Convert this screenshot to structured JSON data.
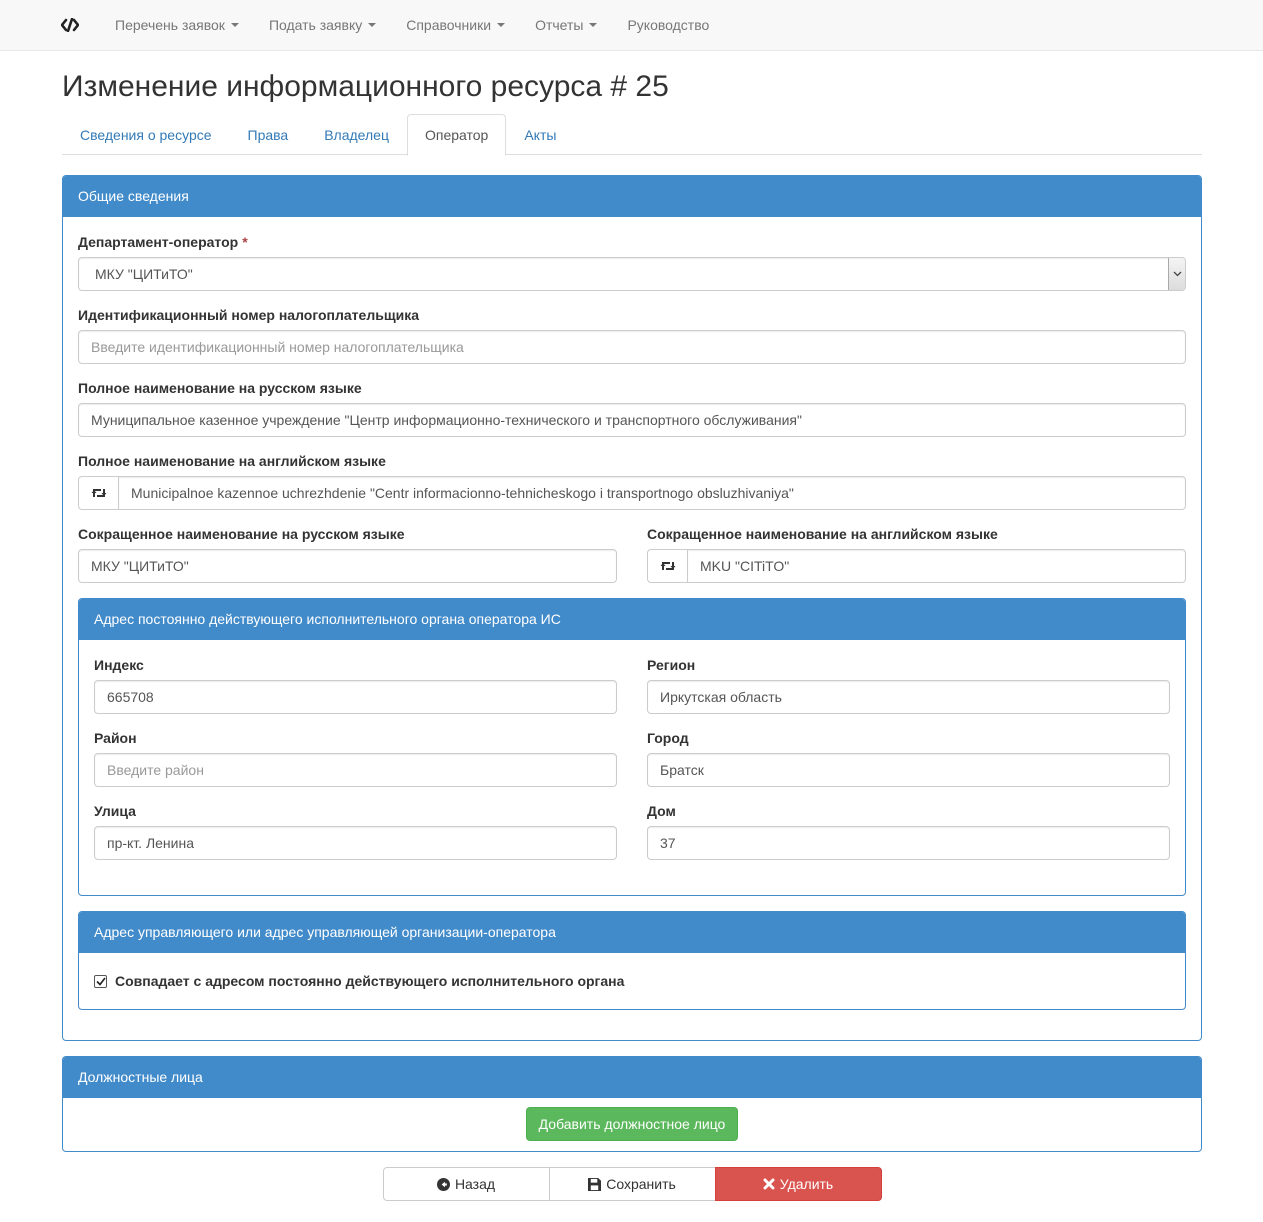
{
  "nav": {
    "items": [
      {
        "label": "Перечень заявок",
        "dropdown": true
      },
      {
        "label": "Подать заявку",
        "dropdown": true
      },
      {
        "label": "Справочники",
        "dropdown": true
      },
      {
        "label": "Отчеты",
        "dropdown": true
      },
      {
        "label": "Руководство",
        "dropdown": false
      }
    ]
  },
  "page": {
    "title": "Изменение информационного ресурса # 25"
  },
  "tabs": [
    {
      "label": "Сведения о ресурсе",
      "active": false
    },
    {
      "label": "Права",
      "active": false
    },
    {
      "label": "Владелец",
      "active": false
    },
    {
      "label": "Оператор",
      "active": true
    },
    {
      "label": "Акты",
      "active": false
    }
  ],
  "general": {
    "heading": "Общие сведения",
    "department": {
      "label": "Департамент-оператор",
      "required_mark": "*",
      "value": "МКУ \"ЦИТиТО\""
    },
    "inn": {
      "label": "Идентификационный номер налогоплательщика",
      "placeholder": "Введите идентификационный номер налогоплательщика"
    },
    "full_ru": {
      "label": "Полное наименование на русском языке",
      "value": "Муниципальное казенное учреждение \"Центр информационно-технического и транспортного обслуживания\""
    },
    "full_en": {
      "label": "Полное наименование на английском языке",
      "value": "Municipalnoe kazennoe uchrezhdenie \"Centr informacionno-tehnicheskogo i transportnogo obsluzhivaniya\""
    },
    "short_ru": {
      "label": "Сокращенное наименование на русском языке",
      "value": "МКУ \"ЦИТиТО\""
    },
    "short_en": {
      "label": "Сокращенное наименование на английском языке",
      "value": "MKU \"CITiTO\""
    }
  },
  "address": {
    "heading": "Адрес постоянно действующего исполнительного органа оператора ИС",
    "index": {
      "label": "Индекс",
      "value": "665708"
    },
    "region": {
      "label": "Регион",
      "value": "Иркутская область"
    },
    "district": {
      "label": "Район",
      "placeholder": "Введите район"
    },
    "city": {
      "label": "Город",
      "value": "Братск"
    },
    "street": {
      "label": "Улица",
      "value": "пр-кт. Ленина"
    },
    "house": {
      "label": "Дом",
      "value": "37"
    }
  },
  "manager_address": {
    "heading": "Адрес управляющего или адрес управляющей организации-оператора",
    "same_checkbox": {
      "label": "Совпадает с адресом постоянно действующего исполнительного органа",
      "checked": true
    }
  },
  "officials": {
    "heading": "Должностные лица",
    "add_button": "Добавить должностное лицо"
  },
  "actions": {
    "back": "Назад",
    "save": "Сохранить",
    "delete": "Удалить"
  },
  "colors": {
    "primary": "#428bca",
    "link": "#337ab7",
    "success": "#5cb85c",
    "danger": "#d9534f"
  },
  "icons": {
    "brand": "brand-logo-icon",
    "swap": "retweet-icon",
    "back": "arrow-circle-left-icon",
    "save": "floppy-disk-icon",
    "delete": "remove-icon",
    "select": "chevron-down-icon",
    "check": "check-icon"
  }
}
